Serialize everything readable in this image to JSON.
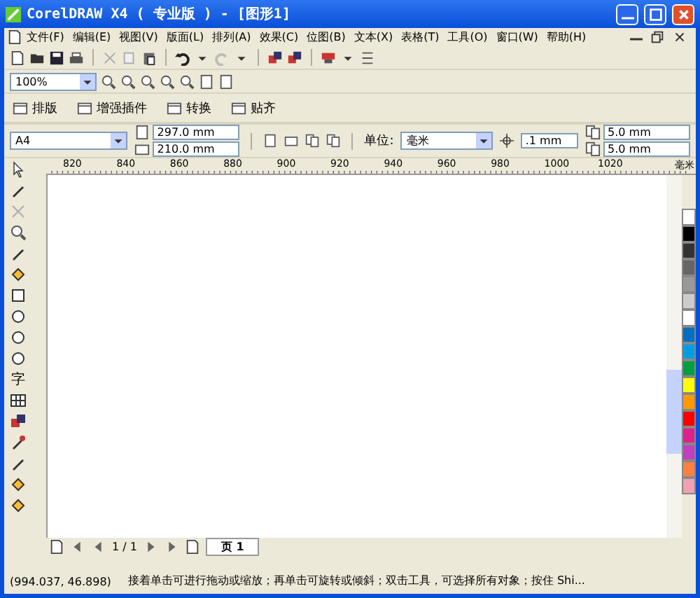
{
  "window": {
    "title": "CorelDRAW X4 ( 专业版 ) - [图形1]"
  },
  "menu": [
    "文件(F)",
    "编辑(E)",
    "视图(V)",
    "版面(L)",
    "排列(A)",
    "效果(C)",
    "位图(B)",
    "文本(X)",
    "表格(T)",
    "工具(O)",
    "窗口(W)",
    "帮助(H)"
  ],
  "zoom": {
    "value": "100%"
  },
  "plugin_bar": [
    "排版",
    "增强插件",
    "转换",
    "贴齐"
  ],
  "property_bar": {
    "paper": "A4",
    "width": "297.0 mm",
    "height": "210.0 mm",
    "unit_label": "单位:",
    "unit": "毫米",
    "nudge": ".1 mm",
    "duplicate_x": "5.0 mm",
    "duplicate_y": "5.0 mm"
  },
  "ruler": {
    "labels": [
      "820",
      "840",
      "860",
      "880",
      "900",
      "920",
      "940",
      "960",
      "980",
      "1000",
      "1020"
    ],
    "unit": "毫米"
  },
  "toolbox": {
    "text_tool": "字"
  },
  "palette": [
    {
      "color": "#ffffff"
    },
    {
      "color": "#000000"
    },
    {
      "color": "#333333"
    },
    {
      "color": "#666666"
    },
    {
      "color": "#999999"
    },
    {
      "color": "#cccccc"
    },
    {
      "color": "#ffffff"
    },
    {
      "color": "#0070c0"
    },
    {
      "color": "#00a0e0"
    },
    {
      "color": "#00a040"
    },
    {
      "color": "#ffff00"
    },
    {
      "color": "#ff9900"
    },
    {
      "color": "#ff0000"
    },
    {
      "color": "#e0208a"
    },
    {
      "color": "#c040c0"
    },
    {
      "color": "#ff8040"
    },
    {
      "color": "#f0a0b0"
    }
  ],
  "page_nav": {
    "position": "1 / 1",
    "tabs": [
      {
        "label": "页 1",
        "selected": true
      }
    ]
  },
  "status_bar": {
    "coordinates": "(994.037, 46.898)",
    "message": "接着单击可进行拖动或缩放；再单击可旋转或倾斜；双击工具，可选择所有对象；按住 Shi..."
  }
}
